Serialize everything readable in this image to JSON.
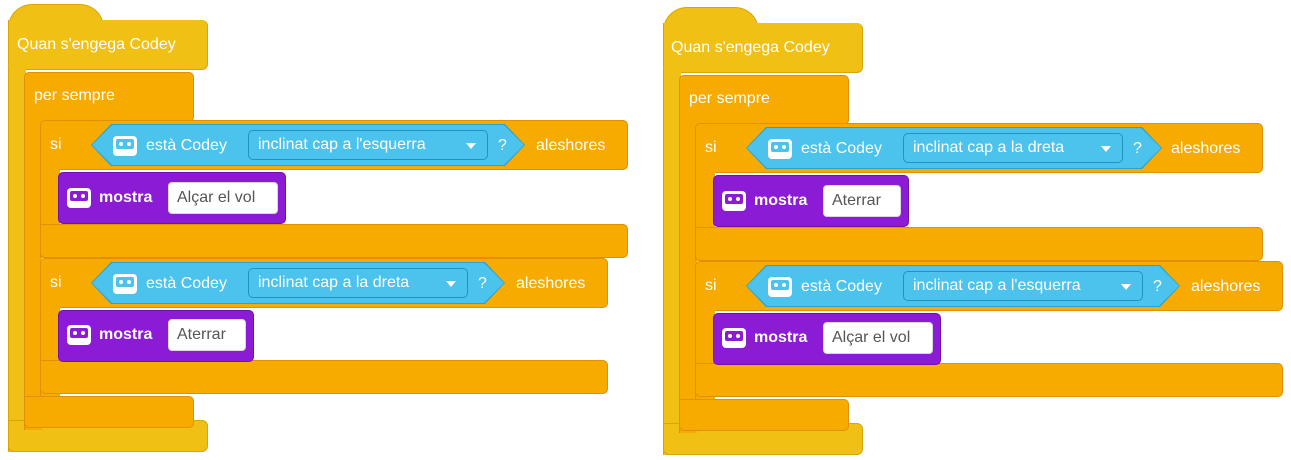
{
  "colors": {
    "event": "#f0c014",
    "control": "#f7ab00",
    "sensing": "#4cc3ec",
    "looks": "#8c1bd6"
  },
  "scripts": [
    {
      "hat_label": "Quan s'engega Codey",
      "forever_label": "per sempre",
      "if_blocks": [
        {
          "if_label": "si",
          "sensing_label": "està Codey",
          "condition": "inclinat cap a l'esquerra",
          "question": "?",
          "then_label": "aleshores",
          "looks_label": "mostra",
          "show_value": "Alçar el vol"
        },
        {
          "if_label": "si",
          "sensing_label": "està Codey",
          "condition": "inclinat cap a la dreta",
          "question": "?",
          "then_label": "aleshores",
          "looks_label": "mostra",
          "show_value": "Aterrar"
        }
      ]
    },
    {
      "hat_label": "Quan s'engega Codey",
      "forever_label": "per sempre",
      "if_blocks": [
        {
          "if_label": "si",
          "sensing_label": "està Codey",
          "condition": "inclinat cap a la dreta",
          "question": "?",
          "then_label": "aleshores",
          "looks_label": "mostra",
          "show_value": "Aterrar"
        },
        {
          "if_label": "si",
          "sensing_label": "està Codey",
          "condition": "inclinat cap a l'esquerra",
          "question": "?",
          "then_label": "aleshores",
          "looks_label": "mostra",
          "show_value": "Alçar el vol"
        }
      ]
    }
  ]
}
